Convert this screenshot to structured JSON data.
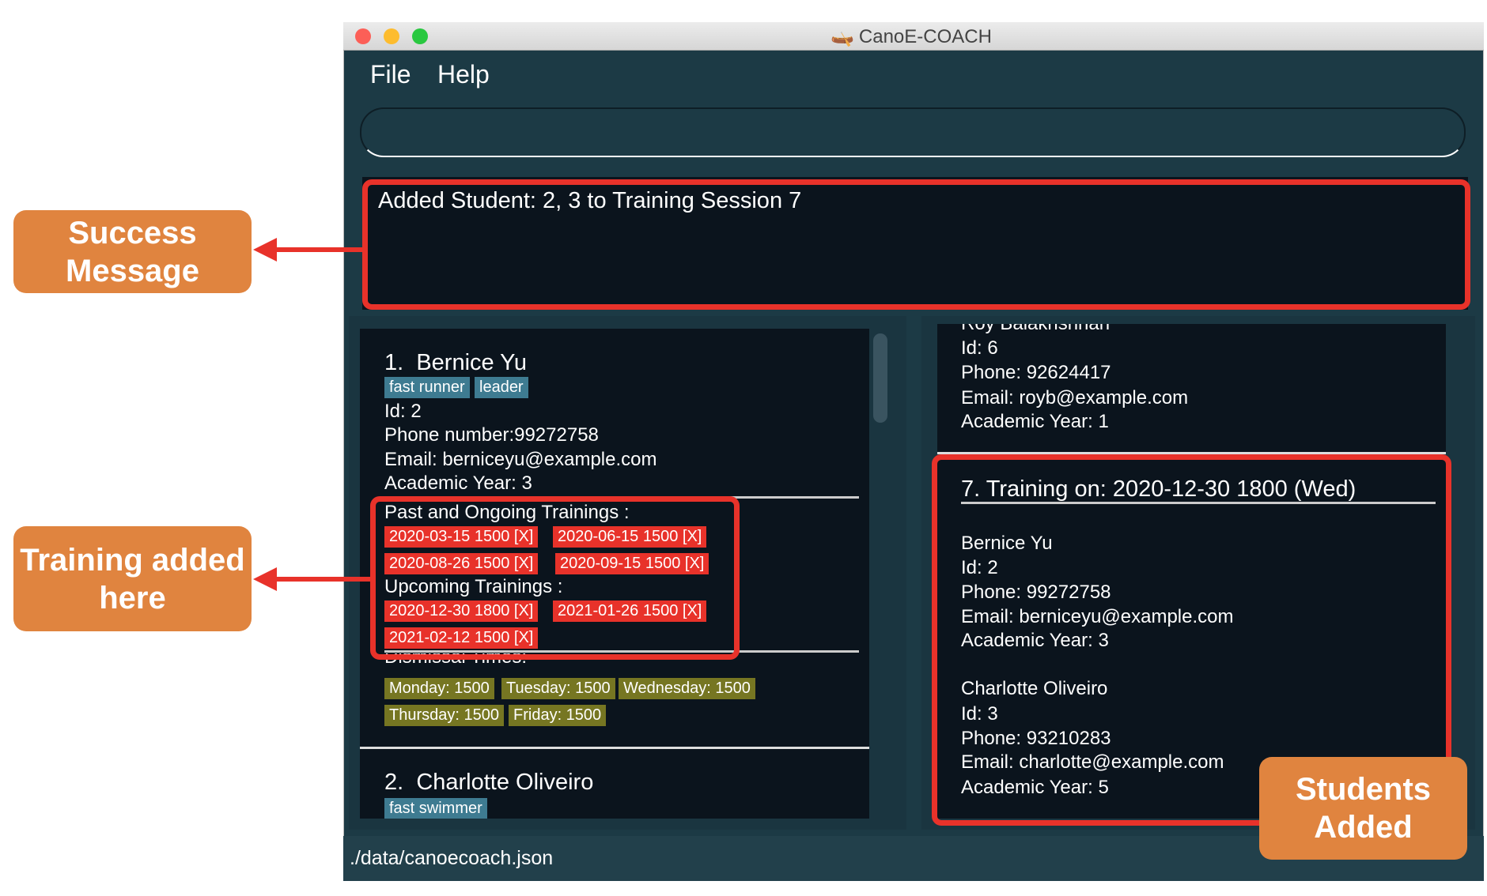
{
  "window": {
    "title": "CanoE-COACH",
    "app_icon": "canoe-icon"
  },
  "menu": {
    "file": "File",
    "help": "Help"
  },
  "command_box": {
    "value": "",
    "placeholder": ""
  },
  "result": {
    "message": "Added Student: 2, 3 to Training Session 7"
  },
  "students": [
    {
      "index": "1.",
      "name": "Bernice Yu",
      "tags": [
        "fast runner",
        "leader"
      ],
      "id": "Id: 2",
      "phone": "Phone number:99272758",
      "email": "Email: berniceyu@example.com",
      "year": "Academic Year: 3",
      "past_label": "Past and Ongoing Trainings :",
      "past": [
        "2020-03-15 1500 [X]",
        "2020-06-15 1500 [X]",
        "2020-08-26 1500 [X]",
        "2020-09-15 1500 [X]"
      ],
      "upcoming_label": "Upcoming Trainings :",
      "upcoming": [
        "2020-12-30 1800 [X]",
        "2021-01-26 1500 [X]",
        "2021-02-12 1500 [X]"
      ],
      "dismissal_label": "Dismissal Times:",
      "dismissal": [
        "Monday: 1500",
        "Tuesday: 1500",
        "Wednesday: 1500",
        "Thursday: 1500",
        "Friday: 1500"
      ]
    },
    {
      "index": "2.",
      "name": "Charlotte Oliveiro",
      "tags": [
        "fast swimmer"
      ]
    }
  ],
  "trainings": {
    "prev_card": {
      "name": "Roy Balakrishnan",
      "id": "Id: 6",
      "phone": "Phone: 92624417",
      "email": "Email: royb@example.com",
      "year": "Academic  Year: 1"
    },
    "card": {
      "title": "7.  Training on: 2020-12-30 1800 (Wed)",
      "students": [
        {
          "name": "Bernice Yu",
          "id": "Id: 2",
          "phone": "Phone: 99272758",
          "email": "Email: berniceyu@example.com",
          "year": "Academic  Year: 3"
        },
        {
          "name": "Charlotte Oliveiro",
          "id": "Id: 3",
          "phone": "Phone: 93210283",
          "email": "Email: charlotte@example.com",
          "year": "Academic  Year: 5"
        }
      ]
    }
  },
  "status_bar": {
    "path": "./data/canoecoach.json"
  },
  "annotations": {
    "success": "Success Message",
    "training": "Training added here",
    "students": "Students Added"
  },
  "colors": {
    "accent_red": "#e8322a",
    "callout": "#e0843f",
    "tag": "#3e7b91",
    "dismissal": "#767622",
    "panel": "#0b141d",
    "window": "#1c3a45"
  }
}
